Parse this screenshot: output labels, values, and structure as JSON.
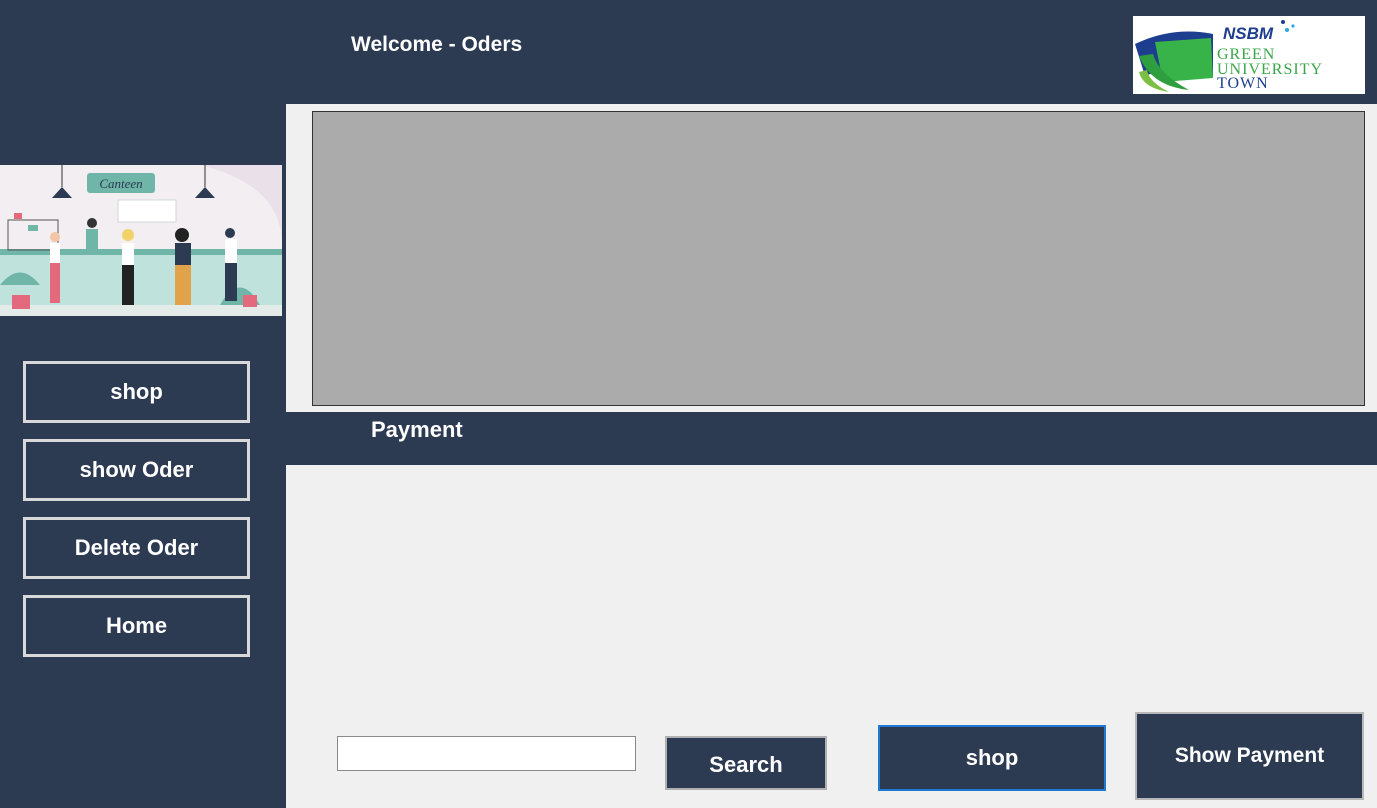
{
  "header": {
    "title": "Welcome - Oders"
  },
  "logo": {
    "line1": "NSBM",
    "line2": "GREEN",
    "line3": "UNIVERSITY",
    "line4": "TOWN"
  },
  "banner": {
    "sign": "Canteen"
  },
  "sidebar": {
    "buttons": [
      {
        "label": "shop"
      },
      {
        "label": "show Oder"
      },
      {
        "label": "Delete Oder"
      },
      {
        "label": "Home"
      }
    ]
  },
  "main": {
    "section_label": "Payment",
    "search": {
      "value": "",
      "button": "Search"
    },
    "shop_button": "shop",
    "show_payment_button": "Show Payment"
  },
  "colors": {
    "panel": "#2c3a52",
    "content": "#f0f0f0",
    "grid": "#ababab"
  }
}
